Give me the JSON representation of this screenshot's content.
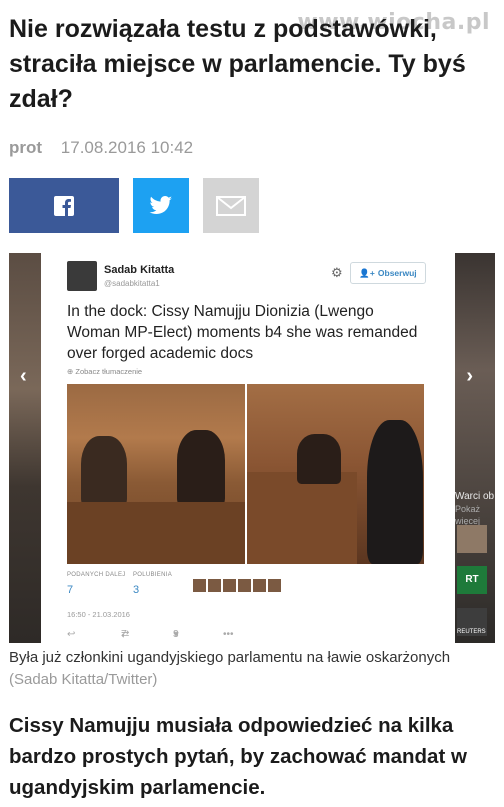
{
  "watermark": "www.wiocha.pl",
  "article": {
    "headline": "Nie rozwiązała testu z podstawówki, straciła miejsce w parlamencie. Ty byś zdał?",
    "author": "prot",
    "date": "17.08.2016 10:42"
  },
  "share": {
    "facebook_icon": "facebook-icon",
    "twitter_icon": "twitter-icon",
    "email_icon": "email-icon"
  },
  "gallery": {
    "prev_arrow": "‹",
    "next_arrow": "›",
    "side_headline": "Warci ob",
    "side_subline": "Pokaż więcej",
    "side_items": [
      "K",
      "R",
      "R"
    ],
    "side_logo_label": "RT",
    "side_reuters_label": "REUTERS"
  },
  "tweet": {
    "author_name": "Sadab Kitatta",
    "author_handle": "@sadabkitatta1",
    "follow_label": "Obserwuj",
    "text": "In the dock: Cissy Namujju Dionizia (Lwengo Woman MP-Elect) moments b4 she was remanded over forged academic docs",
    "translate_label": "Zobacz tłumaczenie",
    "retweets_label": "PODANYCH DALEJ",
    "retweets_count": "7",
    "likes_label": "POLUBIENIA",
    "likes_count": "3",
    "timestamp": "16:50 - 21.03.2016",
    "action_retweet_count": "7",
    "action_like_count": "3"
  },
  "caption": {
    "text": "Była już członkini ugandyjskiego parlamentu na ławie oskarżonych",
    "credit": "(Sadab Kitatta/Twitter)"
  },
  "lead": "Cissy Namujju musiała odpowiedzieć na kilka bardzo prostych pytań, by zachować mandat w ugandyjskim parlamencie.",
  "colors": {
    "facebook": "#3b5998",
    "twitter": "#1da1f2",
    "email": "#d4d4d4",
    "link_blue": "#3b88c3"
  }
}
